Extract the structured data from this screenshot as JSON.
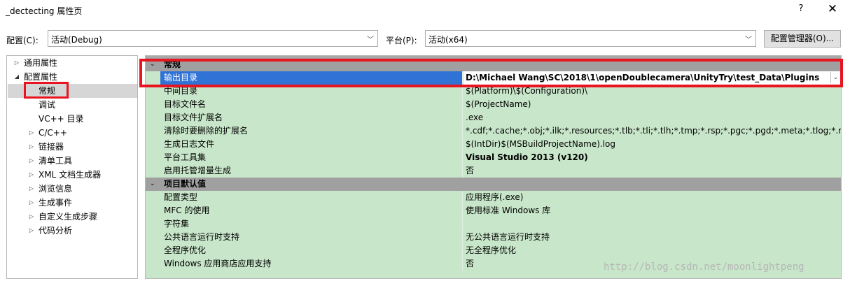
{
  "window": {
    "title": "_dectecting 属性页",
    "help": "?",
    "close": "✕"
  },
  "toolbar": {
    "config_label": "配置(C):",
    "config_value": "活动(Debug)",
    "platform_label": "平台(P):",
    "platform_value": "活动(x64)",
    "config_manager": "配置管理器(O)..."
  },
  "tree": [
    {
      "label": "通用属性",
      "expander": "▷",
      "indent": 0
    },
    {
      "label": "配置属性",
      "expander": "◢",
      "indent": 0
    },
    {
      "label": "常规",
      "expander": "",
      "indent": 1
    },
    {
      "label": "调试",
      "expander": "",
      "indent": 1
    },
    {
      "label": "VC++ 目录",
      "expander": "",
      "indent": 1
    },
    {
      "label": "C/C++",
      "expander": "▷",
      "indent": 1
    },
    {
      "label": "链接器",
      "expander": "▷",
      "indent": 1
    },
    {
      "label": "清单工具",
      "expander": "▷",
      "indent": 1
    },
    {
      "label": "XML 文档生成器",
      "expander": "▷",
      "indent": 1
    },
    {
      "label": "浏览信息",
      "expander": "▷",
      "indent": 1
    },
    {
      "label": "生成事件",
      "expander": "▷",
      "indent": 1
    },
    {
      "label": "自定义生成步骤",
      "expander": "▷",
      "indent": 1
    },
    {
      "label": "代码分析",
      "expander": "▷",
      "indent": 1
    }
  ],
  "grid": {
    "categories": [
      {
        "name": "常规",
        "rows": [
          {
            "name": "输出目录",
            "value": "D:\\Michael Wang\\SC\\2018\\1\\openDoublecamera\\UnityTry\\test_Data\\Plugins",
            "selected": true
          },
          {
            "name": "中间目录",
            "value": "$(Platform)\\$(Configuration)\\"
          },
          {
            "name": "目标文件名",
            "value": "$(ProjectName)"
          },
          {
            "name": "目标文件扩展名",
            "value": ".exe"
          },
          {
            "name": "清除时要删除的扩展名",
            "value": "*.cdf;*.cache;*.obj;*.ilk;*.resources;*.tlb;*.tli;*.tlh;*.tmp;*.rsp;*.pgc;*.pgd;*.meta;*.tlog;*.manifest;*"
          },
          {
            "name": "生成日志文件",
            "value": "$(IntDir)$(MSBuildProjectName).log"
          },
          {
            "name": "平台工具集",
            "value": "Visual Studio 2013 (v120)",
            "bold": true
          },
          {
            "name": "启用托管增量生成",
            "value": "否"
          }
        ]
      },
      {
        "name": "项目默认值",
        "rows": [
          {
            "name": "配置类型",
            "value": "应用程序(.exe)"
          },
          {
            "name": "MFC 的使用",
            "value": "使用标准 Windows 库"
          },
          {
            "name": "字符集",
            "value": ""
          },
          {
            "name": "公共语言运行时支持",
            "value": "无公共语言运行时支持"
          },
          {
            "name": "全程序优化",
            "value": "无全程序优化"
          },
          {
            "name": "Windows 应用商店应用支持",
            "value": "否"
          }
        ]
      }
    ]
  },
  "watermark": "http://blog.csdn.net/moonlightpeng"
}
